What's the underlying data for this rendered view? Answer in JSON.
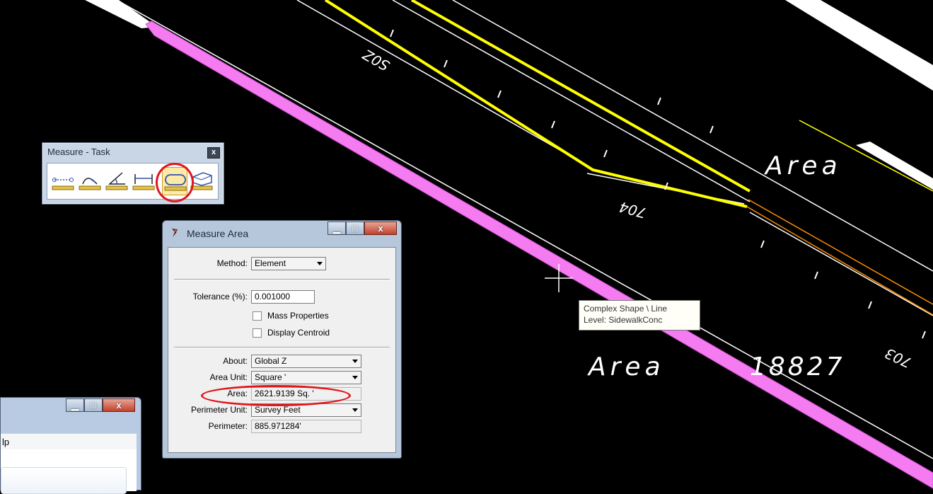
{
  "canvas": {
    "area_labels": [
      "Area",
      "Area",
      "18827"
    ],
    "station_labels": [
      "S0Z",
      "704",
      "703"
    ],
    "colors": {
      "background": "#000000",
      "highlight": "#f47cf0",
      "centerline": "#ffff00",
      "orange": "#ff8c00",
      "white": "#ffffff"
    }
  },
  "measure_task": {
    "title": "Measure - Task",
    "close_glyph": "x",
    "tools": [
      {
        "name": "measure-distance-icon"
      },
      {
        "name": "measure-radius-icon"
      },
      {
        "name": "measure-angle-icon"
      },
      {
        "name": "measure-length-icon"
      },
      {
        "name": "measure-area-icon",
        "selected": true
      },
      {
        "name": "measure-volume-icon"
      }
    ]
  },
  "measure_area": {
    "title": "Measure Area",
    "method_label": "Method:",
    "method_value": "Element",
    "tolerance_label": "Tolerance (%):",
    "tolerance_value": "0.001000",
    "mass_properties_label": "Mass Properties",
    "display_centroid_label": "Display Centroid",
    "about_label": "About:",
    "about_value": "Global Z",
    "area_unit_label": "Area Unit:",
    "area_unit_value": "Square '",
    "area_label": "Area:",
    "area_value": "2621.9139 Sq. '",
    "perimeter_unit_label": "Perimeter Unit:",
    "perimeter_unit_value": "Survey Feet",
    "perimeter_label": "Perimeter:",
    "perimeter_value": "885.971284'"
  },
  "tooltip": {
    "line1": "Complex Shape \\ Line",
    "line2": "Level: SidewalkConc"
  },
  "partial_window": {
    "menu_fragment": "lp"
  }
}
